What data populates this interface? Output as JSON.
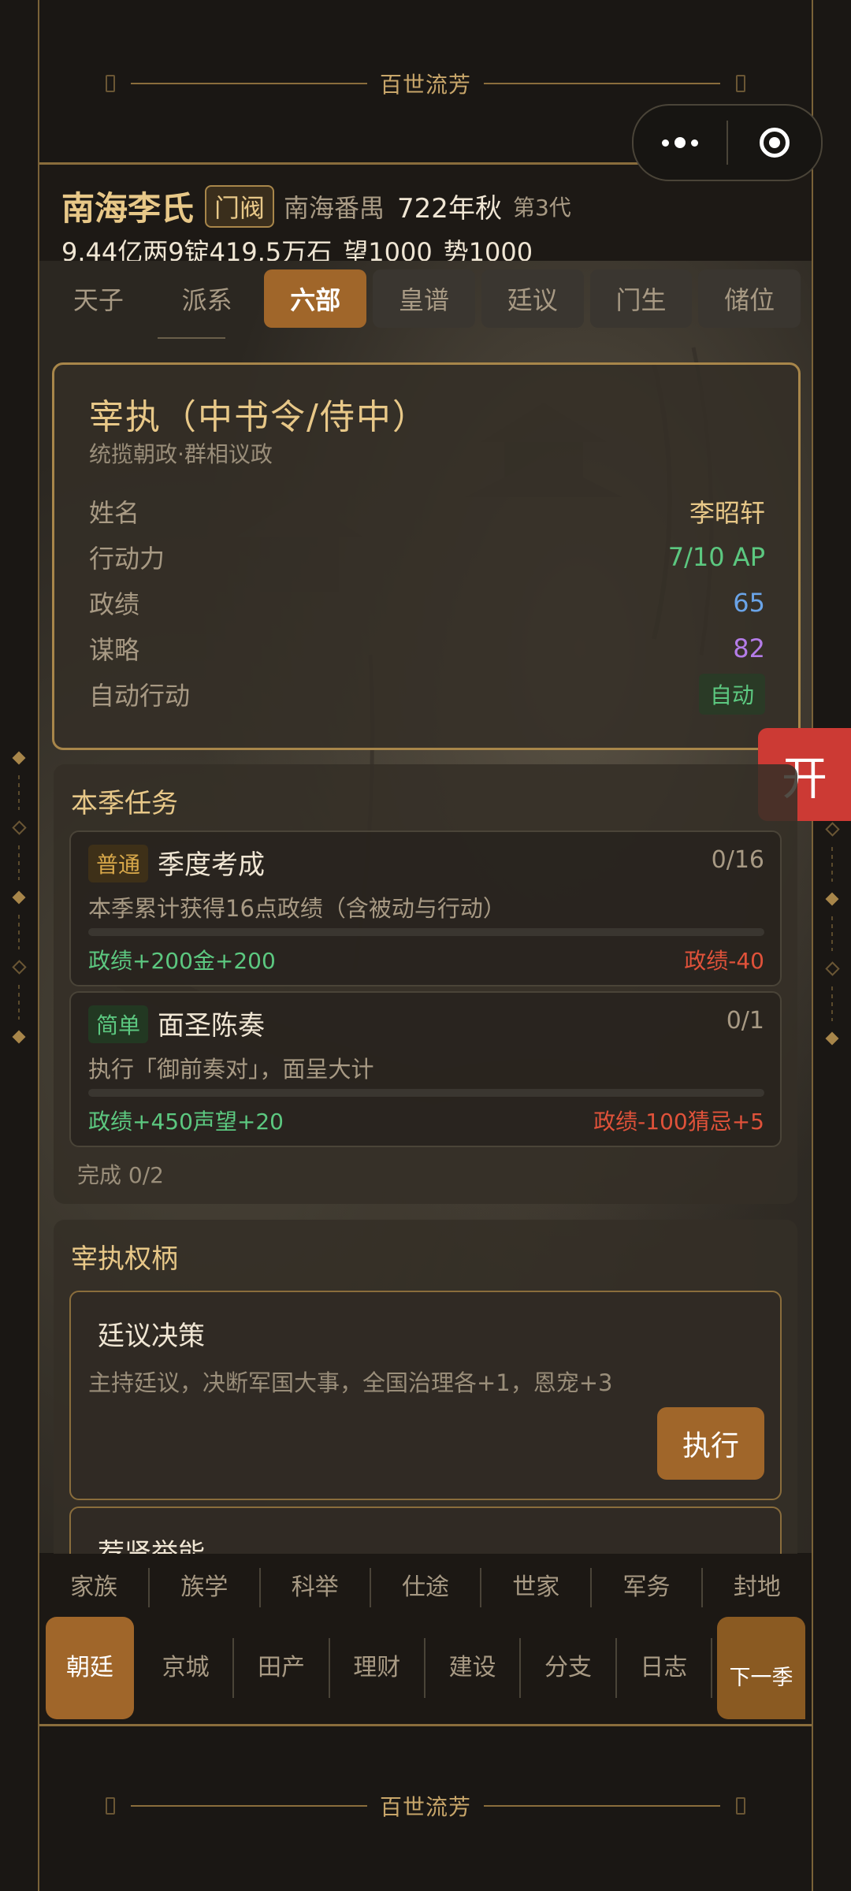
{
  "banner": {
    "title": "百世流芳"
  },
  "header": {
    "clan_name": "南海李氏",
    "rank": "门阀",
    "region": "南海番禺",
    "date": "722年秋",
    "generation": "第3代",
    "wealth": "9.44亿两9锭419.5万石",
    "prestige": "望1000",
    "power": "势1000"
  },
  "top_tabs": [
    {
      "label": "天子"
    },
    {
      "label": "派系"
    },
    {
      "label": "六部"
    },
    {
      "label": "皇谱"
    },
    {
      "label": "廷议"
    },
    {
      "label": "门生"
    },
    {
      "label": "储位"
    }
  ],
  "minister": {
    "title": "宰执（中书令/侍中）",
    "subtitle": "统揽朝政·群相议政",
    "rows": [
      {
        "key": "姓名",
        "value": "李昭轩"
      },
      {
        "key": "行动力",
        "value": "7/10 AP"
      },
      {
        "key": "政绩",
        "value": "65"
      },
      {
        "key": "谋略",
        "value": "82"
      },
      {
        "key": "自动行动",
        "value": "自动"
      }
    ]
  },
  "side_button": {
    "label": "开"
  },
  "tasks": {
    "title": "本季任务",
    "items": [
      {
        "difficulty": "普通",
        "name": "季度考成",
        "progress": "0/16",
        "desc": "本季累计获得16点政绩（含被动与行动）",
        "reward": "政绩+200金+200",
        "penalty": "政绩-40",
        "fill": 0
      },
      {
        "difficulty": "简单",
        "name": "面圣陈奏",
        "progress": "0/1",
        "desc": "执行「御前奏对」，面呈大计",
        "reward": "政绩+450声望+20",
        "penalty": "政绩-100猜忌+5",
        "fill": 0
      }
    ],
    "complete": "完成 0/2"
  },
  "power_section": {
    "title": "宰执权柄",
    "items": [
      {
        "title": "廷议决策",
        "desc": "主持廷议，决断军国大事，全国治理各+1，恩宠+3",
        "button": "执行"
      },
      {
        "title": "荐贤举能"
      }
    ]
  },
  "bottom_nav": {
    "row1": [
      "家族",
      "族学",
      "科举",
      "仕途",
      "世家",
      "军务",
      "封地"
    ],
    "row2": [
      "朝廷",
      "京城",
      "田产",
      "理财",
      "建设",
      "分支",
      "日志"
    ],
    "next": "下一季"
  },
  "colors": {
    "accent": "#a0662a",
    "gold": "#e8c888",
    "green": "#5cc880",
    "red": "#e0523a",
    "blue": "#6aa4e8",
    "purple": "#b47ce8"
  }
}
